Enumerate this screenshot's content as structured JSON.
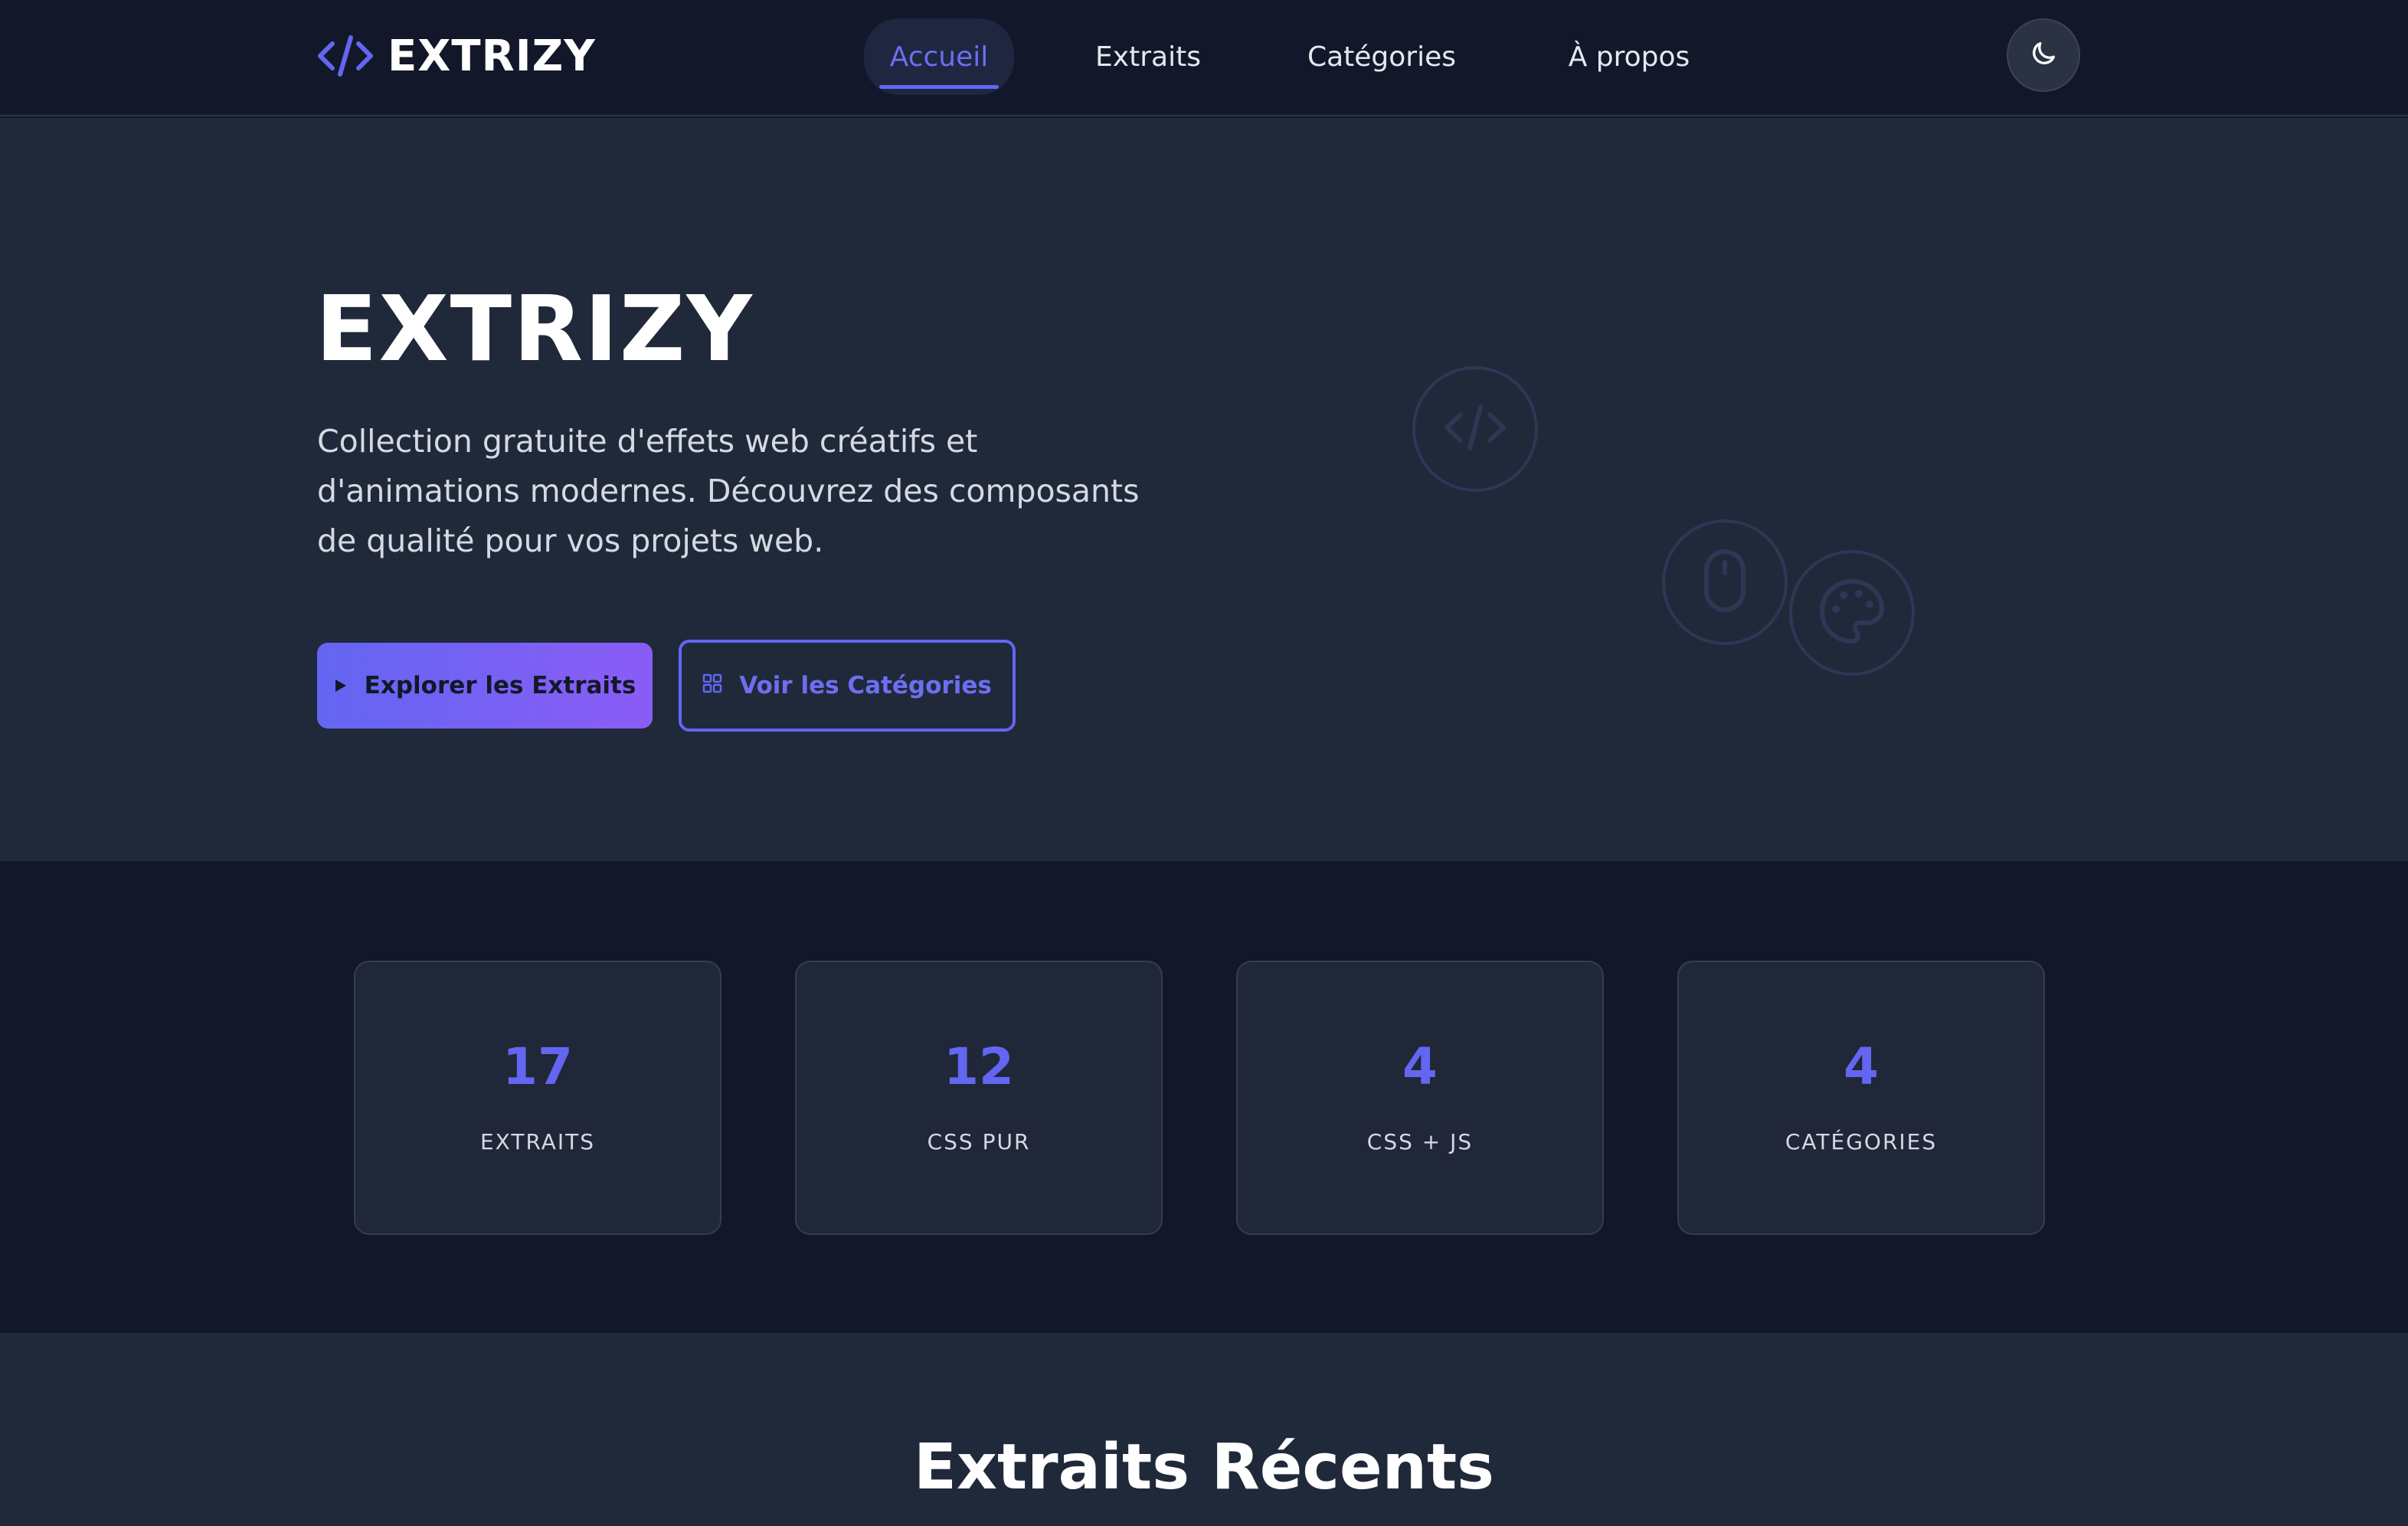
{
  "header": {
    "logo_text": "EXTRIZY",
    "logo_icon": "code-icon",
    "nav": [
      {
        "label": "Accueil",
        "active": true
      },
      {
        "label": "Extraits",
        "active": false
      },
      {
        "label": "Catégories",
        "active": false
      },
      {
        "label": "À propos",
        "active": false
      }
    ],
    "theme_icon": "moon-icon"
  },
  "hero": {
    "title": "EXTRIZY",
    "description": "Collection gratuite d'effets web créatifs et d'animations modernes. Découvrez des composants de qualité pour vos projets web.",
    "primary_button": {
      "label": "Explorer les Extraits",
      "icon": "play-icon"
    },
    "secondary_button": {
      "label": "Voir les Catégories",
      "icon": "grid-icon"
    },
    "decorative_icons": [
      "code-icon",
      "mouse-icon",
      "palette-icon"
    ]
  },
  "stats": [
    {
      "value": "17",
      "label": "EXTRAITS"
    },
    {
      "value": "12",
      "label": "CSS PUR"
    },
    {
      "value": "4",
      "label": "CSS + JS"
    },
    {
      "value": "4",
      "label": "CATÉGORIES"
    }
  ],
  "recent": {
    "title": "Extraits Récents"
  },
  "colors": {
    "accent": "#6366f1",
    "accent_end": "#8b5cf6",
    "background": "#121829",
    "surface": "#20293a"
  }
}
